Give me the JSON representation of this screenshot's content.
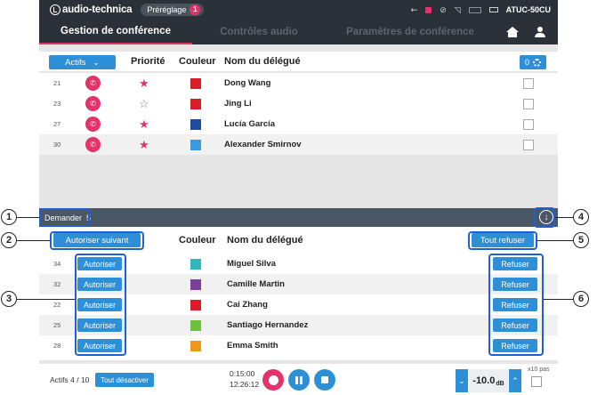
{
  "statusbar": {
    "logo": "audio-technica",
    "preset_label": "Préréglage",
    "preset_count": "1",
    "device_name": "ATUC-50CU",
    "icons": [
      "usb-icon",
      "record-indicator-icon",
      "lock-icon",
      "signal-icon",
      "battery-icon"
    ]
  },
  "tabs": [
    {
      "label": "Gestion de conférence",
      "active": true
    },
    {
      "label": "Contrôles audio",
      "active": false
    },
    {
      "label": "Paramètres de conférence",
      "active": false
    }
  ],
  "speakers": {
    "filter_label": "Actifs",
    "headers": {
      "priority": "Priorité",
      "color": "Couleur",
      "name": "Nom du délégué"
    },
    "count_label": "0",
    "rows": [
      {
        "seat": "21",
        "starred": true,
        "color": "#d81e28",
        "name": "Dong Wang"
      },
      {
        "seat": "23",
        "starred": false,
        "color": "#d81e28",
        "name": "Jing Li"
      },
      {
        "seat": "27",
        "starred": true,
        "color": "#1f4c9c",
        "name": "Lucía García"
      },
      {
        "seat": "30",
        "starred": true,
        "color": "#3a9be0",
        "name": "Alexander Smirnov"
      }
    ]
  },
  "requests": {
    "label": "Demander",
    "count": "5",
    "authorize_next": "Autoriser suivant",
    "refuse_all": "Tout refuser",
    "headers": {
      "color": "Couleur",
      "name": "Nom du délégué"
    },
    "authorize_label": "Autoriser",
    "refuse_label": "Refuser",
    "rows": [
      {
        "seat": "34",
        "color": "#30b8c0",
        "name": "Miguel Silva"
      },
      {
        "seat": "32",
        "color": "#7d3f9c",
        "name": "Camille Martin"
      },
      {
        "seat": "22",
        "color": "#d81e28",
        "name": "Cai Zhang"
      },
      {
        "seat": "25",
        "color": "#6cc23a",
        "name": "Santiago Hernandez"
      },
      {
        "seat": "28",
        "color": "#f0961e",
        "name": "Emma Smith"
      }
    ]
  },
  "footer": {
    "active_count": "Actifs 4 / 10",
    "all_off_label": "Tout désactiver",
    "elapsed": "0:15:00",
    "clock": "12:26:12",
    "volume": "-10.0",
    "volume_unit": "dB",
    "x10_label": "x10 pas"
  },
  "callouts": [
    "1",
    "2",
    "3",
    "4",
    "5",
    "6"
  ],
  "colors": {
    "accent_blue": "#2d8fd5",
    "accent_pink": "#e3336b",
    "header_dark": "#2b3138",
    "frame_blue": "#1f5fd4"
  }
}
